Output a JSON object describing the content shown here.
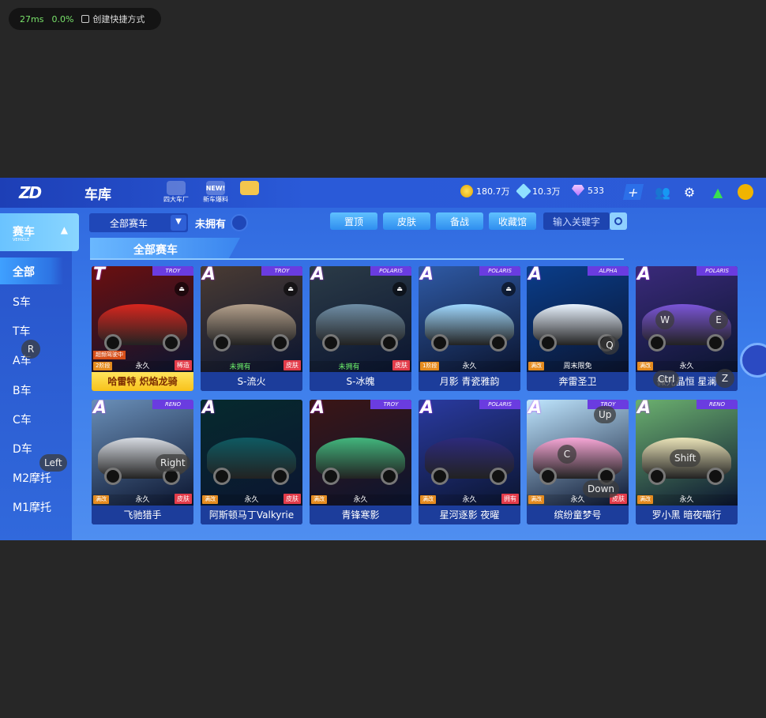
{
  "perf": {
    "latency": "27ms",
    "loss": "0.0%",
    "shortcut_label": "创建快捷方式"
  },
  "topbar": {
    "logo": "ZD",
    "title": "车库",
    "icons": [
      {
        "name": "four-factories-icon",
        "label": "四大车厂",
        "badge": ""
      },
      {
        "name": "new-car-news-icon",
        "label": "新车爆料",
        "badge": "NEW!"
      },
      {
        "name": "gift-icon",
        "label": "",
        "badge": ""
      }
    ],
    "currency": {
      "coins": "180.7万",
      "gems": "10.3万",
      "diamonds": "533"
    }
  },
  "sidebar": {
    "active": {
      "label": "赛车",
      "sub": "VEHICLE"
    },
    "items": [
      "全部",
      "S车",
      "T车",
      "A车",
      "B车",
      "C车",
      "D车",
      "M2摩托",
      "M1摩托"
    ]
  },
  "filter": {
    "dropdown": "全部赛车",
    "not_owned": "未拥有",
    "tabs": [
      "置顶",
      "皮肤",
      "备战",
      "收藏馆"
    ],
    "search_placeholder": "输入关键字"
  },
  "section_title": "全部赛车",
  "cards": [
    {
      "grade": "T",
      "brand": "TROY",
      "name": "哈雷特 炽焰龙骑",
      "duration": "永久",
      "tagL": "2阶段",
      "tagR": "稀造",
      "drive": "超频驾驶中",
      "owned": "",
      "gold": true,
      "color": "#d8261e",
      "bg": "#6b0f0f"
    },
    {
      "grade": "A",
      "brand": "TROY",
      "name": "S-流火",
      "duration": "",
      "tagL": "",
      "tagR": "皮肤",
      "drive": "",
      "owned": "未拥有",
      "gold": false,
      "color": "#b4a08c",
      "bg": "#4a3b33"
    },
    {
      "grade": "A",
      "brand": "POLARIS",
      "name": "S-冰魄",
      "duration": "",
      "tagL": "",
      "tagR": "皮肤",
      "drive": "",
      "owned": "未拥有",
      "gold": false,
      "color": "#6f8ea6",
      "bg": "#2b3b47"
    },
    {
      "grade": "A",
      "brand": "POLARIS",
      "name": "月影 青瓷雅韵",
      "duration": "永久",
      "tagL": "1阶段",
      "tagR": "",
      "drive": "",
      "owned": "",
      "gold": false,
      "color": "#9fd8ff",
      "bg": "#2f5aa5"
    },
    {
      "grade": "A",
      "brand": "ALPHA",
      "name": "奔雷圣卫",
      "duration": "周末限免",
      "tagL": "满改",
      "tagR": "",
      "drive": "",
      "owned": "",
      "gold": false,
      "color": "#e9f3ff",
      "bg": "#0a3d8a"
    },
    {
      "grade": "A",
      "brand": "POLARIS",
      "name": "微光晶恒 星澜",
      "duration": "永久",
      "tagL": "满改",
      "tagR": "",
      "drive": "",
      "owned": "",
      "gold": false,
      "color": "#7b56d8",
      "bg": "#3a2a7a"
    },
    {
      "grade": "A",
      "brand": "RENO",
      "name": "飞驰猎手",
      "duration": "永久",
      "tagL": "满改",
      "tagR": "皮肤",
      "drive": "",
      "owned": "",
      "gold": false,
      "color": "#d7dbe2",
      "bg": "#6a8fb8"
    },
    {
      "grade": "A",
      "brand": "",
      "name": "阿斯顿马丁Valkyrie",
      "duration": "永久",
      "tagL": "满改",
      "tagR": "皮肤",
      "drive": "",
      "owned": "",
      "gold": false,
      "color": "#0e5a62",
      "bg": "#062a2e"
    },
    {
      "grade": "A",
      "brand": "TROY",
      "name": "青锋寒影",
      "duration": "永久",
      "tagL": "满改",
      "tagR": "",
      "drive": "",
      "owned": "",
      "gold": false,
      "color": "#42b67d",
      "bg": "#3b1515"
    },
    {
      "grade": "A",
      "brand": "POLARIS",
      "name": "星河逐影 夜曜",
      "duration": "永久",
      "tagL": "满改",
      "tagR": "拥有",
      "drive": "",
      "owned": "",
      "gold": false,
      "color": "#2d2a7c",
      "bg": "#2a3aa0"
    },
    {
      "grade": "A",
      "brand": "TROY",
      "name": "缤纷童梦号",
      "duration": "永久",
      "tagL": "满改",
      "tagR": "皮肤",
      "drive": "",
      "owned": "",
      "gold": false,
      "color": "#f7a6d6",
      "bg": "#bfe6ff"
    },
    {
      "grade": "A",
      "brand": "RENO",
      "name": "罗小黑 暗夜喵行",
      "duration": "永久",
      "tagL": "满改",
      "tagR": "",
      "drive": "",
      "owned": "",
      "gold": false,
      "color": "#eae3b8",
      "bg": "#6bb06f"
    }
  ],
  "key_overlays": [
    "R",
    "Left",
    "Right",
    "W",
    "E",
    "Q",
    "Ctrl",
    "Z",
    "Up",
    "C",
    "Shift",
    "Down"
  ]
}
